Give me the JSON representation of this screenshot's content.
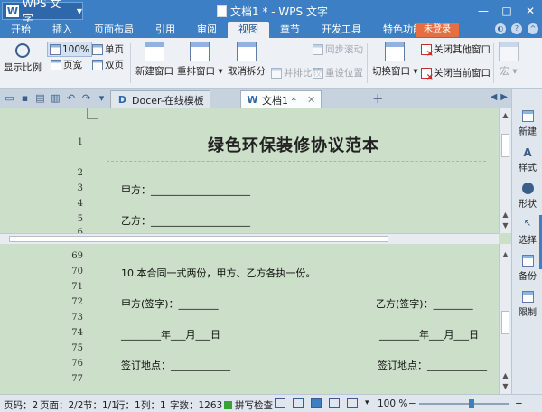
{
  "title_bar": {
    "app_name": "WPS 文字",
    "window_title": "文档1 * - WPS 文字",
    "buttons": [
      "minimize",
      "maximize",
      "close"
    ]
  },
  "ribbon_tabs": [
    "开始",
    "插入",
    "页面布局",
    "引用",
    "审阅",
    "视图",
    "章节",
    "开发工具",
    "特色功能"
  ],
  "active_tab": "视图",
  "login_label": "未登录",
  "ribbon": {
    "zoom_label": "显示比例",
    "zoom_100": "100%",
    "single_page": "单页",
    "page_width": "页宽",
    "double_page": "双页",
    "new_window": "新建窗口",
    "arrange_window": "重排窗口",
    "cancel_split": "取消拆分",
    "side_by_side": "并排比较",
    "sync_scroll": "同步滚动",
    "reset_position": "重设位置",
    "switch_window": "切换窗口",
    "close_other_windows": "关闭其他窗口",
    "close_current_window": "关闭当前窗口",
    "macro": "宏"
  },
  "doc_tabs": [
    {
      "label": "Docer-在线模板",
      "active": false
    },
    {
      "label": "文档1 *",
      "active": true
    }
  ],
  "task_pane": [
    "新建",
    "样式",
    "形状",
    "选择",
    "备份",
    "限制"
  ],
  "pane1": {
    "line_numbers": [
      "1",
      "2",
      "3",
      "4",
      "5",
      "6"
    ],
    "title": "绿色环保装修协议范本",
    "party_a": "甲方：____________________",
    "party_b": "乙方：____________________"
  },
  "pane2": {
    "line_numbers": [
      "69",
      "70",
      "71",
      "72",
      "73",
      "74",
      "75",
      "76",
      "77"
    ],
    "line70": "10.本合同一式两份，甲方、乙方各执一份。",
    "sign_a": "甲方(签字)：________",
    "sign_b": "乙方(签字)：________",
    "date_a": "________年___月___日",
    "date_b": "________年___月___日",
    "place_a": "签订地点：____________",
    "place_b": "签订地点：____________"
  },
  "status": {
    "page_code": "页码：2",
    "pages": "页面：2/2",
    "section": "节：1/1",
    "row": "行：1",
    "column": "列：1",
    "word_count": "字数：1263",
    "spell_check": "拼写检查",
    "zoom": "100 %"
  },
  "colors": {
    "title_bar": "#3d7fc4",
    "doc_background": "#ccdfc9",
    "login_button": "#e46f43"
  }
}
